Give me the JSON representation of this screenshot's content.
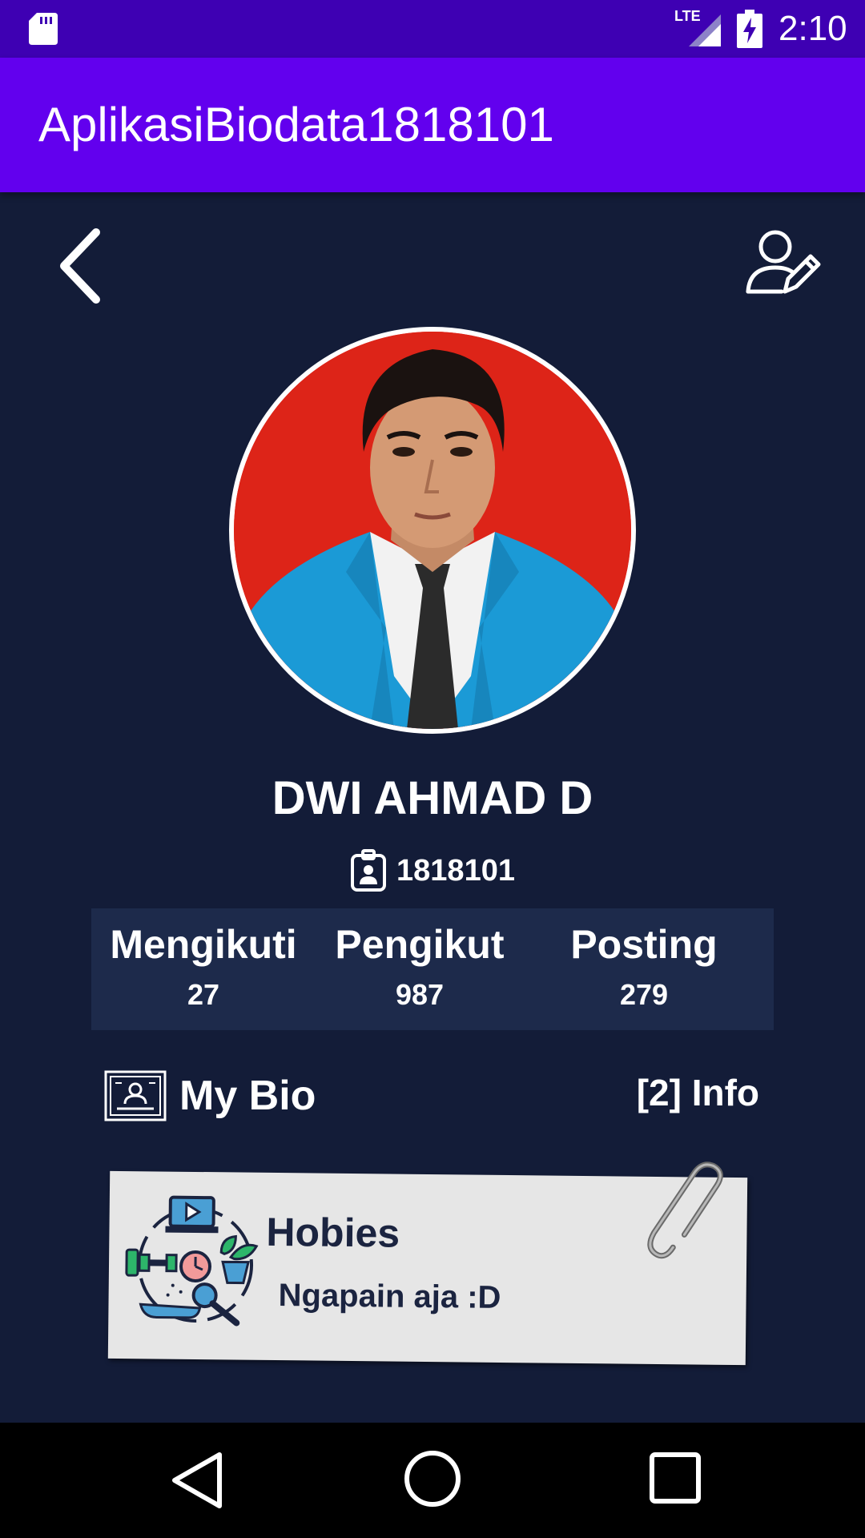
{
  "status_bar": {
    "time": "2:10",
    "network": "LTE",
    "icons": [
      "sd-card-icon",
      "signal-icon",
      "battery-charging-icon"
    ]
  },
  "app_bar": {
    "title": "AplikasiBiodata1818101"
  },
  "toolbar": {
    "back_icon": "chevron-left-icon",
    "edit_icon": "user-edit-icon"
  },
  "profile": {
    "avatar_icon": "profile-photo",
    "name": "DWI AHMAD D",
    "id_icon": "id-badge-icon",
    "id": "1818101"
  },
  "stats": [
    {
      "label": "Mengikuti",
      "value": "27"
    },
    {
      "label": "Pengikut",
      "value": "987"
    },
    {
      "label": "Posting",
      "value": "279"
    }
  ],
  "bio": {
    "icon": "bio-card-icon",
    "title": "My Bio",
    "info": "[2] Info"
  },
  "hobby": {
    "illustration": "hobbies-illustration",
    "title": "Hobies",
    "text": "Ngapain aja :D"
  },
  "nav_bar": {
    "icons": [
      "nav-back-icon",
      "nav-home-icon",
      "nav-recent-icon"
    ]
  },
  "colors": {
    "status_bar": "#3e00b3",
    "app_bar": "#6200ee",
    "background": "#131c38",
    "stats_panel": "#1d2a4b",
    "card": "#e6e6e6",
    "avatar_bg": "#dd2418"
  }
}
